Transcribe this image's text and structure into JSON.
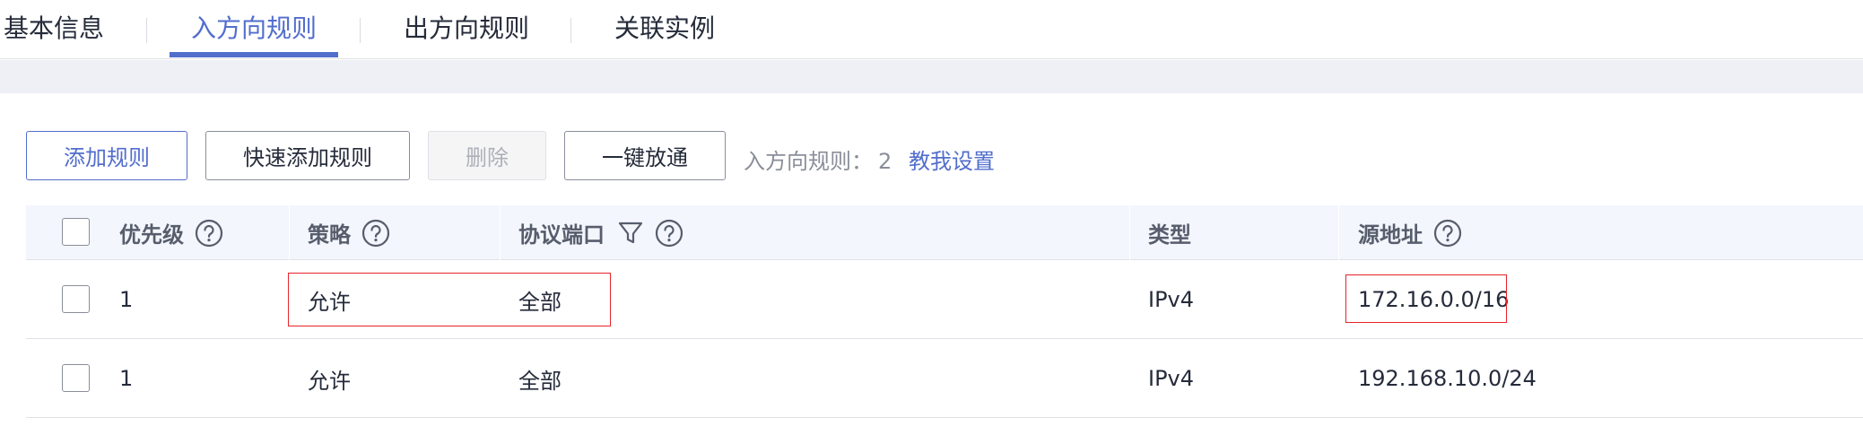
{
  "tabs": [
    {
      "label": "基本信息",
      "active": false
    },
    {
      "label": "入方向规则",
      "active": true
    },
    {
      "label": "出方向规则",
      "active": false
    },
    {
      "label": "关联实例",
      "active": false
    }
  ],
  "toolbar": {
    "add_rule": "添加规则",
    "quick_add_rule": "快速添加规则",
    "delete": "删除",
    "one_click_allow": "一键放通",
    "rule_count_label": "入方向规则：",
    "rule_count_value": "2",
    "teach_link": "教我设置"
  },
  "table": {
    "headers": {
      "priority": "优先级",
      "policy": "策略",
      "protocol_port": "协议端口",
      "type": "类型",
      "source_address": "源地址"
    },
    "rows": [
      {
        "priority": "1",
        "policy": "允许",
        "protocol_port": "全部",
        "type": "IPv4",
        "source_address": "172.16.0.0/16"
      },
      {
        "priority": "1",
        "policy": "允许",
        "protocol_port": "全部",
        "type": "IPv4",
        "source_address": "192.168.10.0/24"
      }
    ]
  },
  "icons": {
    "help": "help-circle-icon",
    "filter": "filter-funnel-icon"
  },
  "colors": {
    "accent": "#526ecc",
    "highlight_box": "#e6242b",
    "header_bg": "#f3f6fc",
    "band_bg": "#eef0f5"
  }
}
